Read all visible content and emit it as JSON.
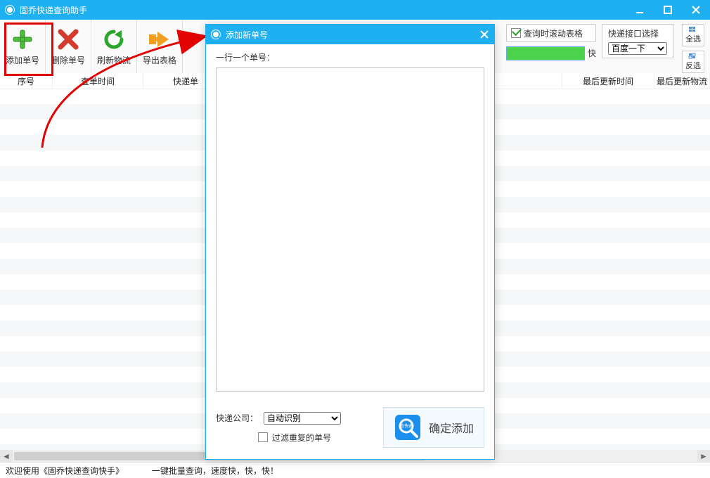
{
  "app": {
    "title": "固乔快递查询助手"
  },
  "toolbar": {
    "add_label": "添加单号",
    "delete_label": "删除单号",
    "refresh_label": "刷新物流",
    "export_label": "导出表格",
    "scroll_on_query": "查询时滚动表格",
    "progress_suffix": "快",
    "api_label": "快递接口选择",
    "api_selected": "百度一下",
    "select_all": "全选",
    "invert_sel": "反选"
  },
  "columns": {
    "seq": "序号",
    "query_time": "查单时间",
    "tracking": "快递单",
    "last_update": "最后更新时间",
    "last_logistics": "最后更新物流"
  },
  "dialog": {
    "title": "添加新单号",
    "hint": "一行一个单号：",
    "company_label": "快递公司：",
    "company_selected": "自动识别",
    "filter_dup": "过滤重复的单号",
    "confirm": "确定添加"
  },
  "status": {
    "left": "欢迎使用《固乔快递查询快手》",
    "mid": "一键批量查询，速度快，快，快！"
  }
}
